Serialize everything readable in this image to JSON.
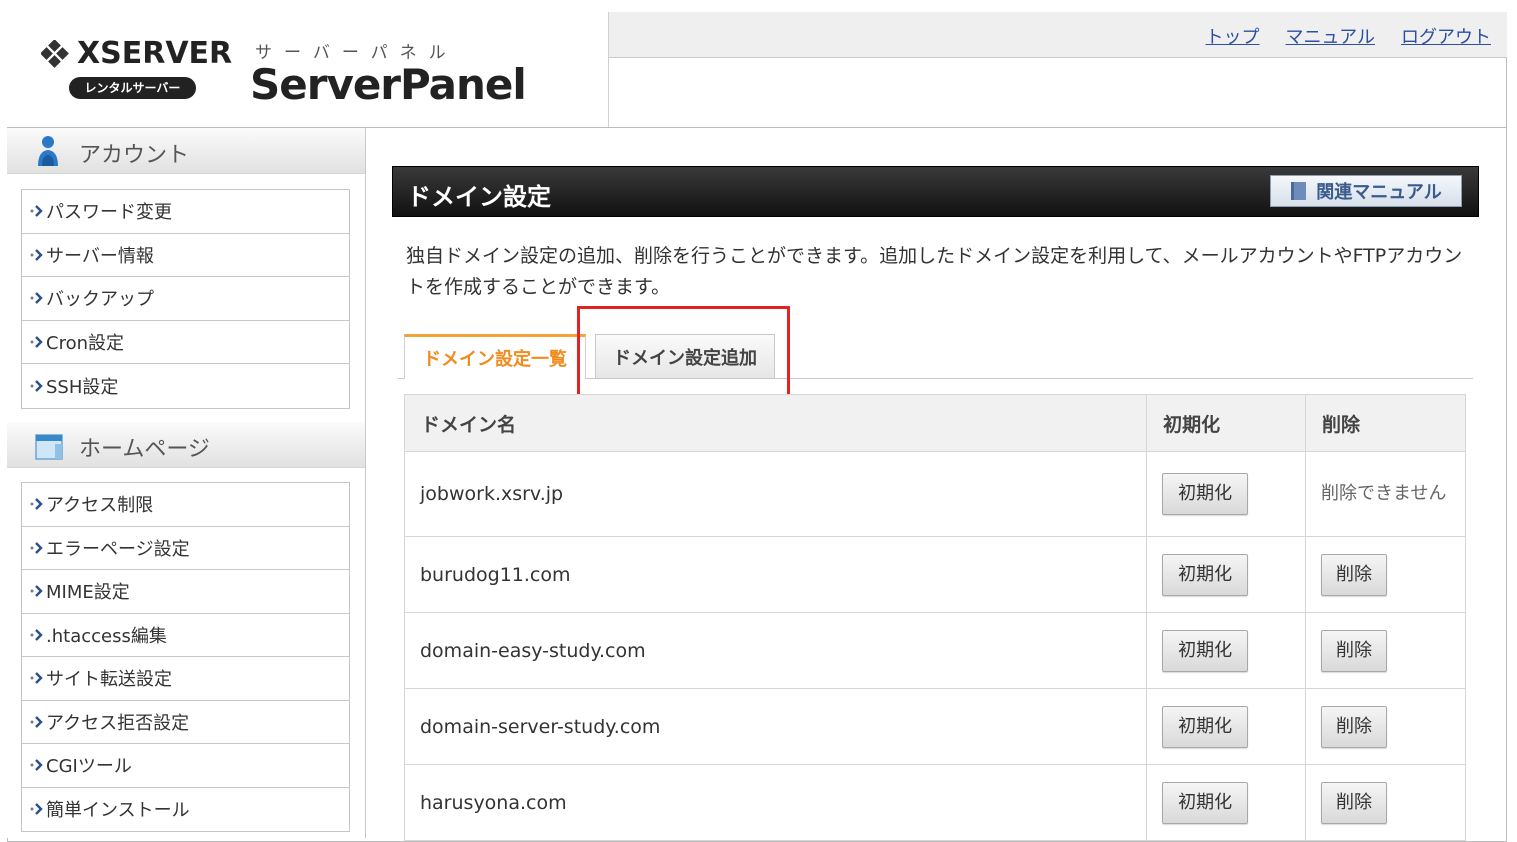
{
  "header": {
    "brand": "XSERVER",
    "brand_sub": "レンタルサーバー",
    "panel_kana": "サーバーパネル",
    "panel_title": "ServerPanel",
    "nav": [
      "トップ",
      "マニュアル",
      "ログアウト"
    ]
  },
  "sidebar": {
    "sections": [
      {
        "title": "アカウント",
        "icon": "user-icon",
        "items": [
          "パスワード変更",
          "サーバー情報",
          "バックアップ",
          "Cron設定",
          "SSH設定"
        ]
      },
      {
        "title": "ホームページ",
        "icon": "homepage-icon",
        "items": [
          "アクセス制限",
          "エラーページ設定",
          "MIME設定",
          ".htaccess編集",
          "サイト転送設定",
          "アクセス拒否設定",
          "CGIツール",
          "簡単インストール"
        ]
      }
    ]
  },
  "main": {
    "title": "ドメイン設定",
    "manual_button": "関連マニュアル",
    "description": "独自ドメイン設定の追加、削除を行うことができます。追加したドメイン設定を利用して、メールアカウントやFTPアカウントを作成することができます。",
    "tabs": [
      "ドメイン設定一覧",
      "ドメイン設定追加"
    ],
    "table": {
      "headers": [
        "ドメイン名",
        "初期化",
        "削除"
      ],
      "rows": [
        {
          "domain": "jobwork.xsrv.jp",
          "init": "初期化",
          "delete": "削除できません",
          "deletable": false
        },
        {
          "domain": "burudog11.com",
          "init": "初期化",
          "delete": "削除",
          "deletable": true
        },
        {
          "domain": "domain-easy-study.com",
          "init": "初期化",
          "delete": "削除",
          "deletable": true
        },
        {
          "domain": "domain-server-study.com",
          "init": "初期化",
          "delete": "削除",
          "deletable": true
        },
        {
          "domain": "harusyona.com",
          "init": "初期化",
          "delete": "削除",
          "deletable": true
        }
      ]
    }
  },
  "colors": {
    "accent_tab": "#f08c1e",
    "highlight": "#e32222",
    "link": "#2d4fa0"
  }
}
